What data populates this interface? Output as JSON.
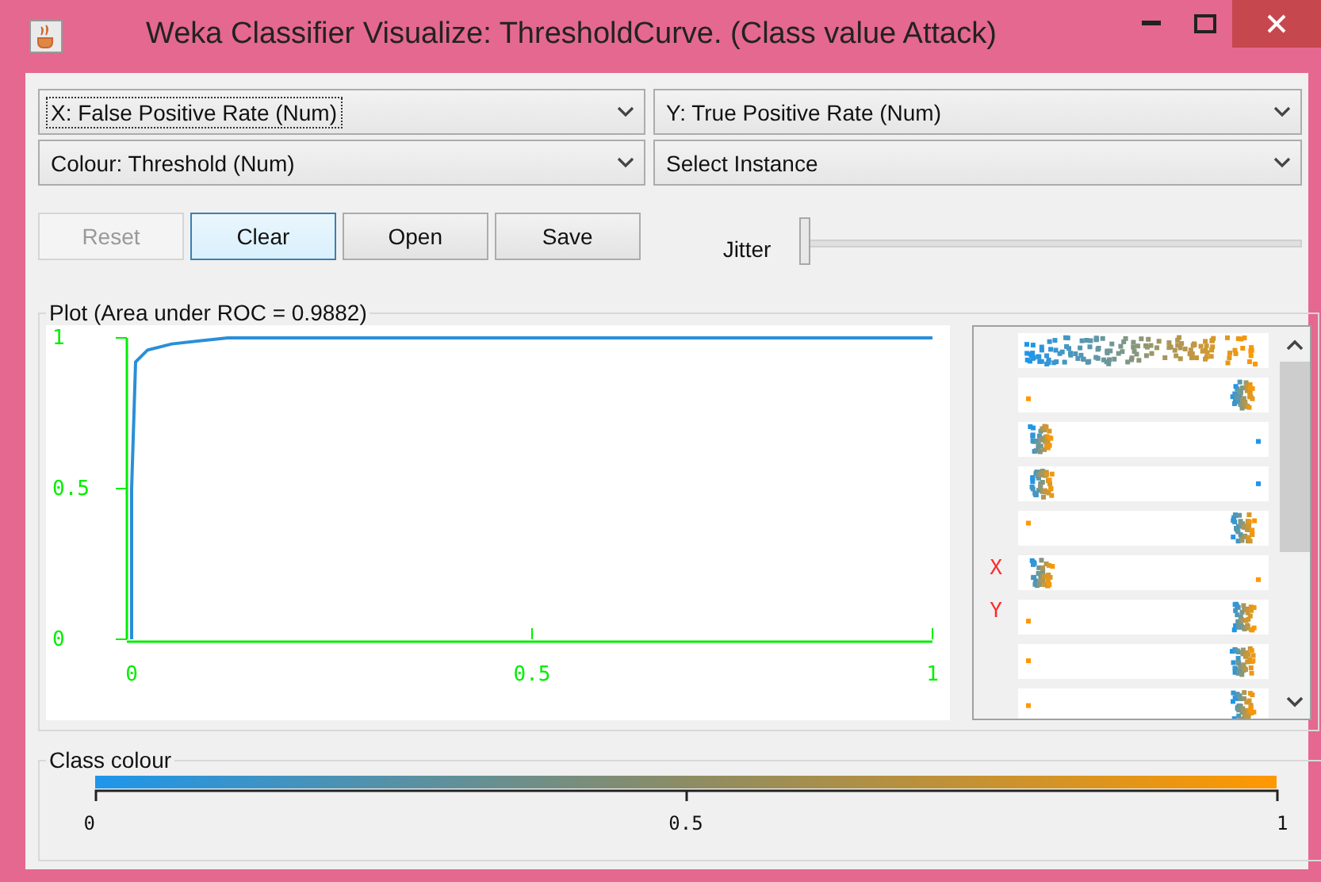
{
  "window": {
    "title": "Weka Classifier Visualize: ThresholdCurve. (Class value Attack)"
  },
  "selectors": [
    {
      "label": "X: False Positive Rate (Num)",
      "focused": true
    },
    {
      "label": "Y: True Positive Rate (Num)",
      "focused": false
    },
    {
      "label": "Colour: Threshold (Num)",
      "focused": false
    },
    {
      "label": "Select Instance",
      "focused": false
    }
  ],
  "buttons": [
    {
      "label": "Reset",
      "disabled": true,
      "selected": false
    },
    {
      "label": "Clear",
      "disabled": false,
      "selected": true
    },
    {
      "label": "Open",
      "disabled": false,
      "selected": false
    },
    {
      "label": "Save",
      "disabled": false,
      "selected": false
    }
  ],
  "jitter": {
    "label": "Jitter",
    "level": 0
  },
  "plot": {
    "title": "Plot (Area under ROC = 0.9882)",
    "chart_data": {
      "type": "line",
      "x": [
        0,
        0,
        0.005,
        0.02,
        0.05,
        0.12,
        0.5,
        1
      ],
      "series": [
        {
          "color": "#2a8fd8",
          "values": [
            0,
            0.5,
            0.92,
            0.96,
            0.98,
            1,
            1,
            1
          ]
        }
      ],
      "xlim": [
        0,
        1
      ],
      "ylim": [
        0,
        1
      ],
      "xticks": [
        {
          "value": 0,
          "label": "0"
        },
        {
          "value": 0.5,
          "label": "0.5"
        },
        {
          "value": 1,
          "label": "1"
        }
      ],
      "yticks": [
        {
          "value": 0,
          "label": "0"
        },
        {
          "value": 0.5,
          "label": "0.5"
        },
        {
          "value": 1,
          "label": "1"
        }
      ]
    },
    "attribute_strips": [
      {
        "kind": "spread"
      },
      {
        "kind": "right"
      },
      {
        "kind": "left"
      },
      {
        "kind": "left"
      },
      {
        "kind": "right"
      },
      {
        "kind": "left",
        "mark": "X"
      },
      {
        "kind": "right",
        "mark": "Y"
      },
      {
        "kind": "right"
      },
      {
        "kind": "right"
      }
    ]
  },
  "class_colour": {
    "title": "Class colour",
    "ticks": [
      "0",
      "0.5",
      "1"
    ]
  }
}
